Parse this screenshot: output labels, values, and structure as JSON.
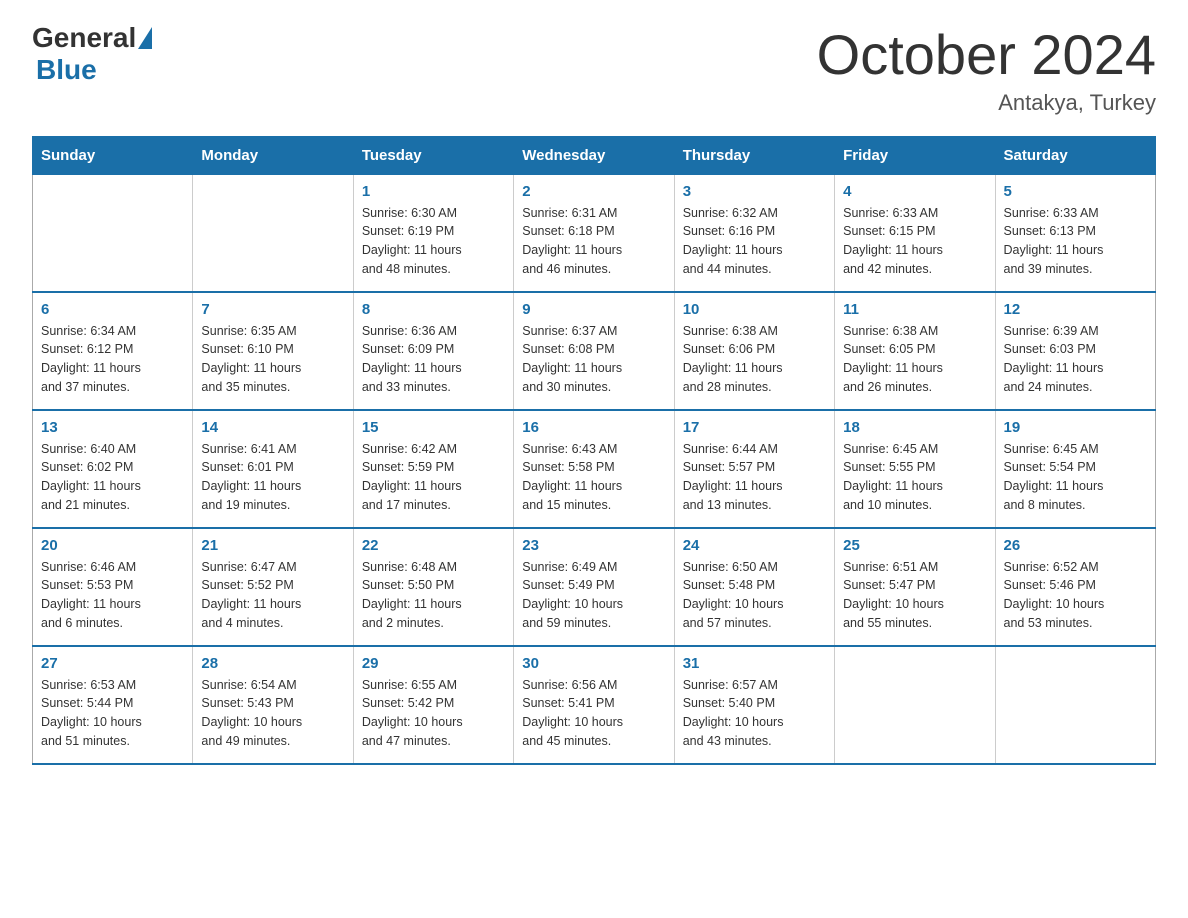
{
  "header": {
    "logo_general": "General",
    "logo_blue": "Blue",
    "title": "October 2024",
    "subtitle": "Antakya, Turkey"
  },
  "days_of_week": [
    "Sunday",
    "Monday",
    "Tuesday",
    "Wednesday",
    "Thursday",
    "Friday",
    "Saturday"
  ],
  "weeks": [
    [
      {
        "day": "",
        "info": ""
      },
      {
        "day": "",
        "info": ""
      },
      {
        "day": "1",
        "info": "Sunrise: 6:30 AM\nSunset: 6:19 PM\nDaylight: 11 hours\nand 48 minutes."
      },
      {
        "day": "2",
        "info": "Sunrise: 6:31 AM\nSunset: 6:18 PM\nDaylight: 11 hours\nand 46 minutes."
      },
      {
        "day": "3",
        "info": "Sunrise: 6:32 AM\nSunset: 6:16 PM\nDaylight: 11 hours\nand 44 minutes."
      },
      {
        "day": "4",
        "info": "Sunrise: 6:33 AM\nSunset: 6:15 PM\nDaylight: 11 hours\nand 42 minutes."
      },
      {
        "day": "5",
        "info": "Sunrise: 6:33 AM\nSunset: 6:13 PM\nDaylight: 11 hours\nand 39 minutes."
      }
    ],
    [
      {
        "day": "6",
        "info": "Sunrise: 6:34 AM\nSunset: 6:12 PM\nDaylight: 11 hours\nand 37 minutes."
      },
      {
        "day": "7",
        "info": "Sunrise: 6:35 AM\nSunset: 6:10 PM\nDaylight: 11 hours\nand 35 minutes."
      },
      {
        "day": "8",
        "info": "Sunrise: 6:36 AM\nSunset: 6:09 PM\nDaylight: 11 hours\nand 33 minutes."
      },
      {
        "day": "9",
        "info": "Sunrise: 6:37 AM\nSunset: 6:08 PM\nDaylight: 11 hours\nand 30 minutes."
      },
      {
        "day": "10",
        "info": "Sunrise: 6:38 AM\nSunset: 6:06 PM\nDaylight: 11 hours\nand 28 minutes."
      },
      {
        "day": "11",
        "info": "Sunrise: 6:38 AM\nSunset: 6:05 PM\nDaylight: 11 hours\nand 26 minutes."
      },
      {
        "day": "12",
        "info": "Sunrise: 6:39 AM\nSunset: 6:03 PM\nDaylight: 11 hours\nand 24 minutes."
      }
    ],
    [
      {
        "day": "13",
        "info": "Sunrise: 6:40 AM\nSunset: 6:02 PM\nDaylight: 11 hours\nand 21 minutes."
      },
      {
        "day": "14",
        "info": "Sunrise: 6:41 AM\nSunset: 6:01 PM\nDaylight: 11 hours\nand 19 minutes."
      },
      {
        "day": "15",
        "info": "Sunrise: 6:42 AM\nSunset: 5:59 PM\nDaylight: 11 hours\nand 17 minutes."
      },
      {
        "day": "16",
        "info": "Sunrise: 6:43 AM\nSunset: 5:58 PM\nDaylight: 11 hours\nand 15 minutes."
      },
      {
        "day": "17",
        "info": "Sunrise: 6:44 AM\nSunset: 5:57 PM\nDaylight: 11 hours\nand 13 minutes."
      },
      {
        "day": "18",
        "info": "Sunrise: 6:45 AM\nSunset: 5:55 PM\nDaylight: 11 hours\nand 10 minutes."
      },
      {
        "day": "19",
        "info": "Sunrise: 6:45 AM\nSunset: 5:54 PM\nDaylight: 11 hours\nand 8 minutes."
      }
    ],
    [
      {
        "day": "20",
        "info": "Sunrise: 6:46 AM\nSunset: 5:53 PM\nDaylight: 11 hours\nand 6 minutes."
      },
      {
        "day": "21",
        "info": "Sunrise: 6:47 AM\nSunset: 5:52 PM\nDaylight: 11 hours\nand 4 minutes."
      },
      {
        "day": "22",
        "info": "Sunrise: 6:48 AM\nSunset: 5:50 PM\nDaylight: 11 hours\nand 2 minutes."
      },
      {
        "day": "23",
        "info": "Sunrise: 6:49 AM\nSunset: 5:49 PM\nDaylight: 10 hours\nand 59 minutes."
      },
      {
        "day": "24",
        "info": "Sunrise: 6:50 AM\nSunset: 5:48 PM\nDaylight: 10 hours\nand 57 minutes."
      },
      {
        "day": "25",
        "info": "Sunrise: 6:51 AM\nSunset: 5:47 PM\nDaylight: 10 hours\nand 55 minutes."
      },
      {
        "day": "26",
        "info": "Sunrise: 6:52 AM\nSunset: 5:46 PM\nDaylight: 10 hours\nand 53 minutes."
      }
    ],
    [
      {
        "day": "27",
        "info": "Sunrise: 6:53 AM\nSunset: 5:44 PM\nDaylight: 10 hours\nand 51 minutes."
      },
      {
        "day": "28",
        "info": "Sunrise: 6:54 AM\nSunset: 5:43 PM\nDaylight: 10 hours\nand 49 minutes."
      },
      {
        "day": "29",
        "info": "Sunrise: 6:55 AM\nSunset: 5:42 PM\nDaylight: 10 hours\nand 47 minutes."
      },
      {
        "day": "30",
        "info": "Sunrise: 6:56 AM\nSunset: 5:41 PM\nDaylight: 10 hours\nand 45 minutes."
      },
      {
        "day": "31",
        "info": "Sunrise: 6:57 AM\nSunset: 5:40 PM\nDaylight: 10 hours\nand 43 minutes."
      },
      {
        "day": "",
        "info": ""
      },
      {
        "day": "",
        "info": ""
      }
    ]
  ]
}
